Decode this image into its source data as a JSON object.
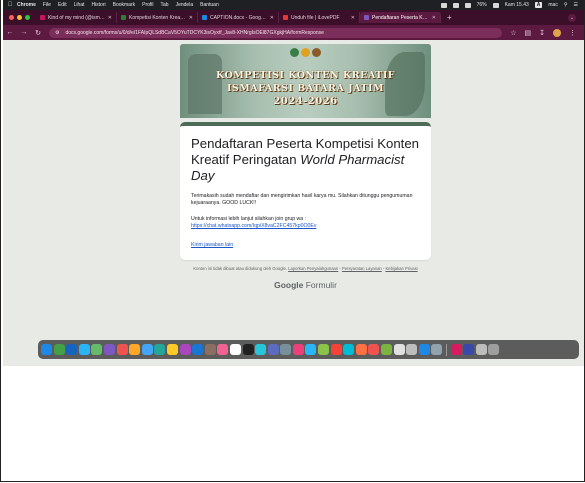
{
  "menubar": {
    "app_name": "Chrome",
    "items": [
      "File",
      "Edit",
      "Lihat",
      "Histori",
      "Bookmark",
      "Profil",
      "Tab",
      "Jendela",
      "Bantuan"
    ],
    "battery": "76%",
    "clock": "Kam 15.43",
    "user": "mac"
  },
  "tabs": [
    {
      "title": "Kind of my mind (@ismazzuh",
      "color": "#c2185b"
    },
    {
      "title": "Kompetisi Konten Kreatif WP",
      "color": "#2e7d32"
    },
    {
      "title": "CAPTION.docx - Google Doc",
      "color": "#1e88e5"
    },
    {
      "title": "Unduh file | iLovePDF",
      "color": "#e53935"
    },
    {
      "title": "Pendaftaran Peserta Kompe",
      "color": "#7e57c2"
    }
  ],
  "address": {
    "url": "docs.google.com/forms/u/0/d/e/1FAIpQLSdBCaV5OYuTDCYK3isOyxtf_Jav8-XHNrgIsOEl87GXgkjHA/formResponse"
  },
  "banner": {
    "line1": "KOMPETISI KONTEN KREATIF",
    "line2": "ISMAFARSI BATARA JATIM",
    "line3": "2024-2026"
  },
  "card": {
    "title_plain": "Pendaftaran Peserta Kompetisi Konten Kreatif Peringatan ",
    "title_italic": "World Pharmacist Day",
    "message": "Terimakasih sudah mendaftar dan mengirimkan hasil karya mu. Silahkan ditunggu pengumuman kejuaraanya. GOOD LUCK!!",
    "join_text": "Untuk informasi lebih lanjut silahkan join grup wa :",
    "join_link": "https://chat.whatsapp.com/IqpiX8vaC2FC457kp0O0Ev",
    "another_response": "Kirim jawaban lain"
  },
  "footer": {
    "text": "Konten ini tidak dibuat atau didukung oleh Google.",
    "link1": "Laporkan Penyalahgunaan",
    "sep1": " - ",
    "link2": "Persyaratan Layanan",
    "sep2": " - ",
    "link3": "Kebijakan Privasi",
    "brand_bold": "Google",
    "brand_rest": " Formulir"
  },
  "dock_colors": [
    "#1e88e5",
    "#43a047",
    "#1565c0",
    "#29b6f6",
    "#66bb6a",
    "#7e57c2",
    "#ef5350",
    "#ffa726",
    "#42a5f5",
    "#26a69a",
    "#ffca28",
    "#ab47bc",
    "#1976d2",
    "#8d6e63",
    "#f06292",
    "#ffffff",
    "#212121",
    "#26c6da",
    "#5c6bc0",
    "#78909c",
    "#ec407a",
    "#29b6f6",
    "#8bc34a",
    "#f44336",
    "#00bcd4",
    "#ff7043",
    "#ef5350",
    "#7cb342",
    "#e0e0e0",
    "#bdbdbd",
    "#1e88e5",
    "#90a4ae",
    "#d81b60",
    "#3949ab",
    "#bdbdbd",
    "#9e9e9e"
  ]
}
